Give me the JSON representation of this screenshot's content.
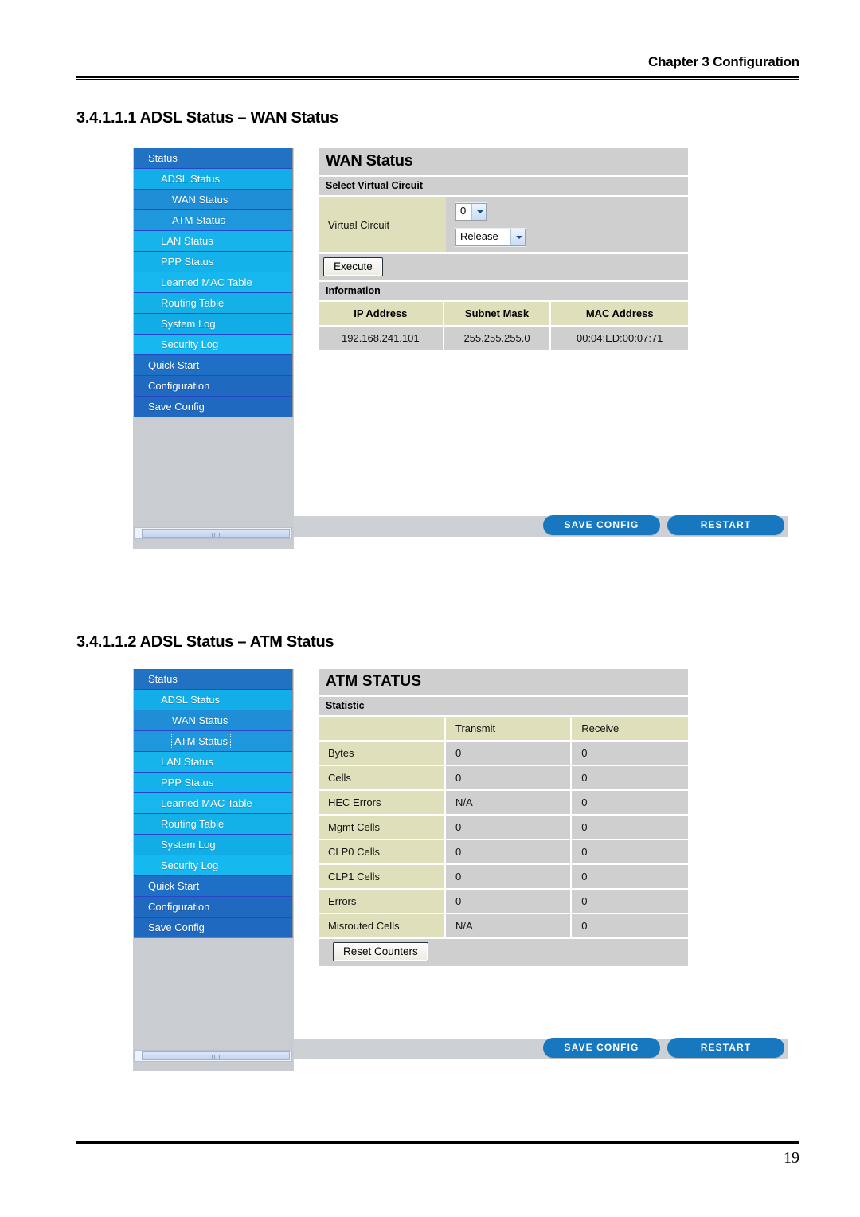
{
  "page": {
    "chapter_header": "Chapter 3 Configuration",
    "page_number": "19",
    "headings": {
      "wan": "3.4.1.1.1 ADSL Status – WAN Status",
      "atm": "3.4.1.1.2 ADSL Status – ATM Status"
    }
  },
  "colors": {
    "accent_blue": "#1778bf",
    "menu_dark_blue": "#2272c4",
    "menu_cyan": "#13aeea",
    "panel_gray": "#cfcfcf",
    "table_khaki": "#dfdfbb"
  },
  "sidebar": {
    "items": [
      {
        "label": "Status",
        "level": 0,
        "class": "mi-status"
      },
      {
        "label": "ADSL Status",
        "level": 1,
        "class": "mi-adsl"
      },
      {
        "label": "WAN Status",
        "level": 2,
        "class": "mi-wan"
      },
      {
        "label": "ATM Status",
        "level": 2,
        "class": "mi-atm"
      },
      {
        "label": "LAN Status",
        "level": 1,
        "class": "mi-lan"
      },
      {
        "label": "PPP Status",
        "level": 1,
        "class": "mi-ppp"
      },
      {
        "label": "Learned MAC Table",
        "level": 1,
        "class": "mi-mac"
      },
      {
        "label": "Routing Table",
        "level": 1,
        "class": "mi-routing"
      },
      {
        "label": "System Log",
        "level": 1,
        "class": "mi-syslog"
      },
      {
        "label": "Security Log",
        "level": 1,
        "class": "mi-seclog"
      },
      {
        "label": "Quick Start",
        "level": 0,
        "class": "mi-quick"
      },
      {
        "label": "Configuration",
        "level": 0,
        "class": "mi-config"
      },
      {
        "label": "Save Config",
        "level": 0,
        "class": "mi-save"
      }
    ]
  },
  "wan_panel": {
    "title": "WAN Status",
    "select_section_title": "Select Virtual Circuit",
    "virtual_circuit_label": "Virtual Circuit",
    "circuit_select_value": "0",
    "action_select_value": "Release",
    "execute_button": "Execute",
    "information_section_title": "Information",
    "table": {
      "headers": [
        "IP Address",
        "Subnet Mask",
        "MAC Address"
      ],
      "rows": [
        [
          "192.168.241.101",
          "255.255.255.0",
          "00:04:ED:00:07:71"
        ]
      ]
    }
  },
  "atm_panel": {
    "title": "ATM STATUS",
    "statistic_section_title": "Statistic",
    "table": {
      "headers": [
        "",
        "Transmit",
        "Receive"
      ],
      "rows": [
        [
          "Bytes",
          "0",
          "0"
        ],
        [
          "Cells",
          "0",
          "0"
        ],
        [
          "HEC Errors",
          "N/A",
          "0"
        ],
        [
          "Mgmt Cells",
          "0",
          "0"
        ],
        [
          "CLP0 Cells",
          "0",
          "0"
        ],
        [
          "CLP1 Cells",
          "0",
          "0"
        ],
        [
          "Errors",
          "0",
          "0"
        ],
        [
          "Misrouted Cells",
          "N/A",
          "0"
        ]
      ]
    },
    "reset_button": "Reset Counters"
  },
  "footer": {
    "save_config": "SAVE CONFIG",
    "restart": "RESTART"
  }
}
